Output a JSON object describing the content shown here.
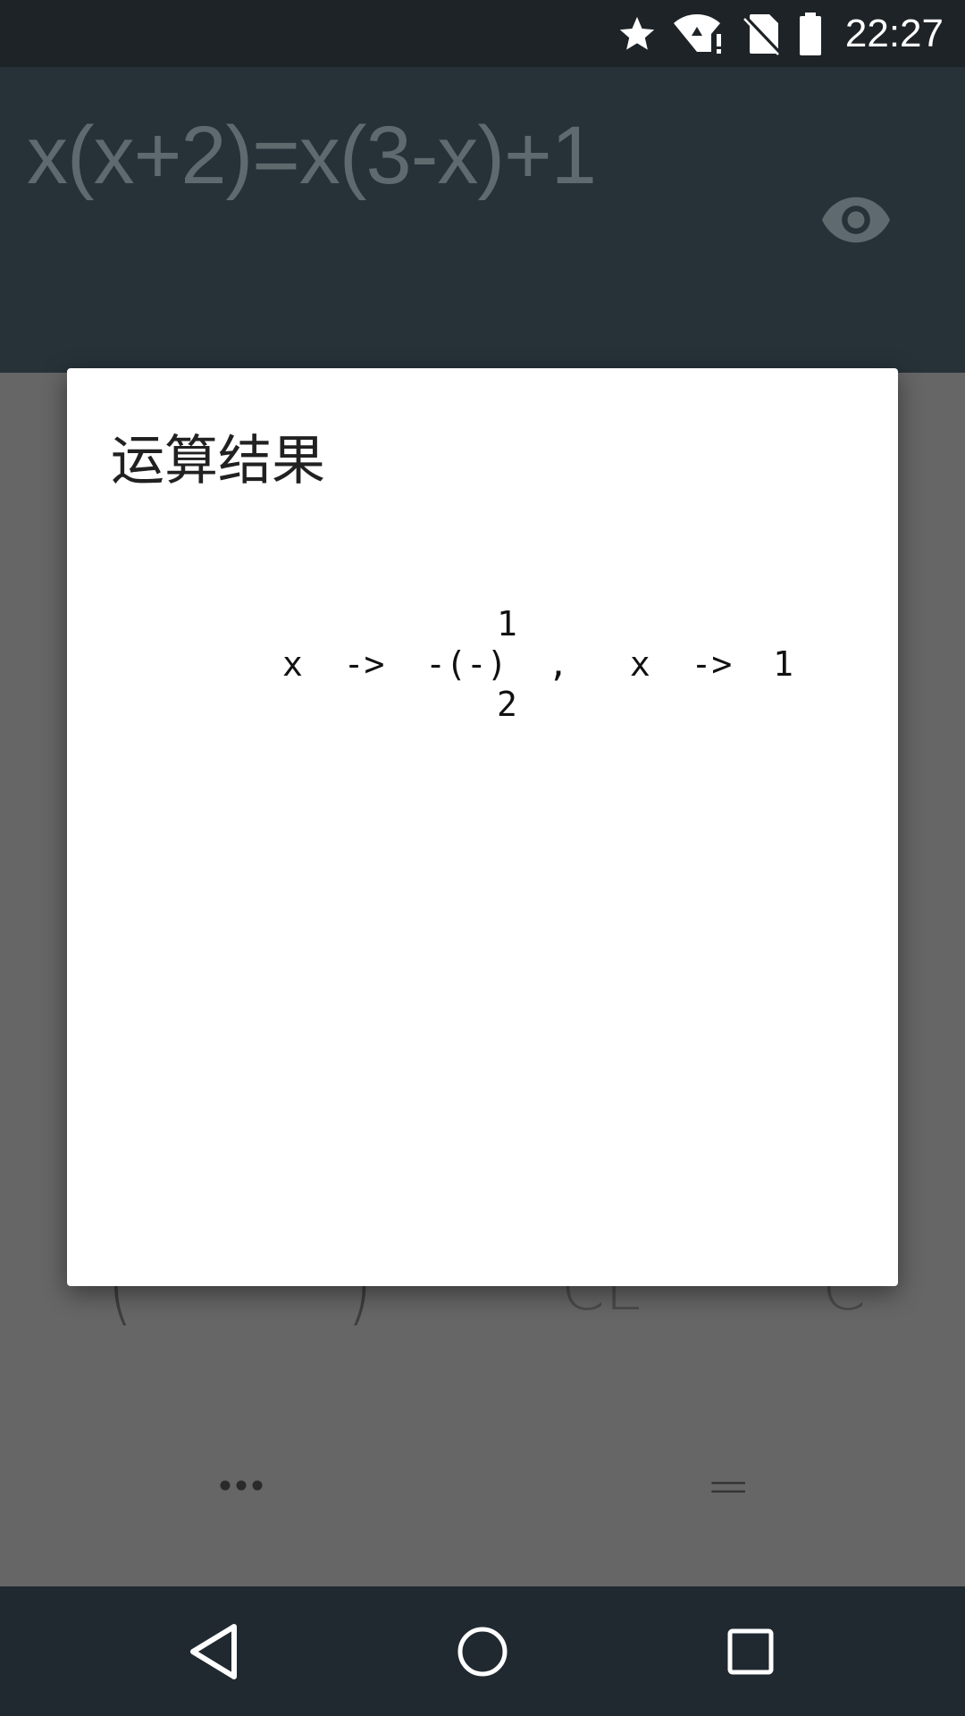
{
  "status_bar": {
    "time": "22:27",
    "icons": [
      "star-icon",
      "wifi-alert-icon",
      "no-sim-icon",
      "battery-icon"
    ]
  },
  "header": {
    "expression": "x(x+2)=x(3-x)+1",
    "toggle_icon": "eye-icon"
  },
  "keypad": {
    "open_paren": "(",
    "close_paren": ")",
    "clear_entry": "CE",
    "clear": "C",
    "more_icon": "more-horizontal-icon",
    "equals": "="
  },
  "dialog": {
    "title": "运算结果",
    "result_lines": [
      "1",
      "x  ->  -(-)  ,   x  ->  1",
      "2"
    ]
  },
  "nav_bar": {
    "icons": [
      "back-icon",
      "home-icon",
      "recent-apps-icon"
    ]
  },
  "colors": {
    "status_bar": "#1d2327",
    "header": "#263238",
    "scrim": "#666666",
    "dialog": "#ffffff",
    "nav_bar": "#212930"
  }
}
